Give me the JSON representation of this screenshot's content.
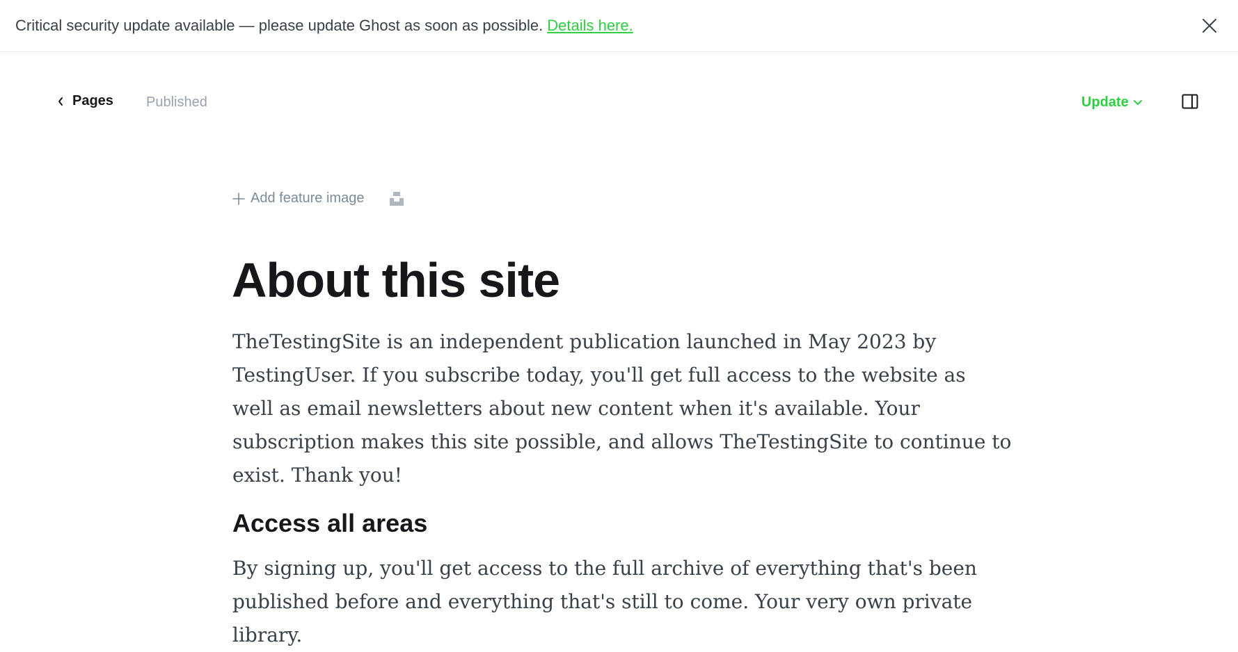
{
  "banner": {
    "message": "Critical security update available — please update Ghost as soon as possible.",
    "link_text": "Details here."
  },
  "header": {
    "back_label": "Pages",
    "status": "Published",
    "update_label": "Update"
  },
  "editor": {
    "add_feature_image": "Add feature image",
    "title": "About this site",
    "paragraph_1": "TheTestingSite is an independent publication launched in May 2023 by TestingUser. If you subscribe today, you'll get full access to the website as well as email newsletters about new content when it's available. Your subscription makes this site possible, and allows TheTestingSite to continue to exist. Thank you!",
    "heading_2": "Access all areas",
    "paragraph_2": "By signing up, you'll get access to the full archive of everything that's been published before and everything that's still to come. Your very own private library."
  },
  "colors": {
    "accent_green": "#30cf43",
    "muted_text": "#98a2ad",
    "body_text": "#394047"
  },
  "icons": {
    "back": "chevron-left-icon",
    "dropdown": "chevron-down-icon",
    "close": "close-icon",
    "sidebar": "sidebar-toggle-icon",
    "add": "plus-icon",
    "unsplash": "unsplash-icon"
  }
}
